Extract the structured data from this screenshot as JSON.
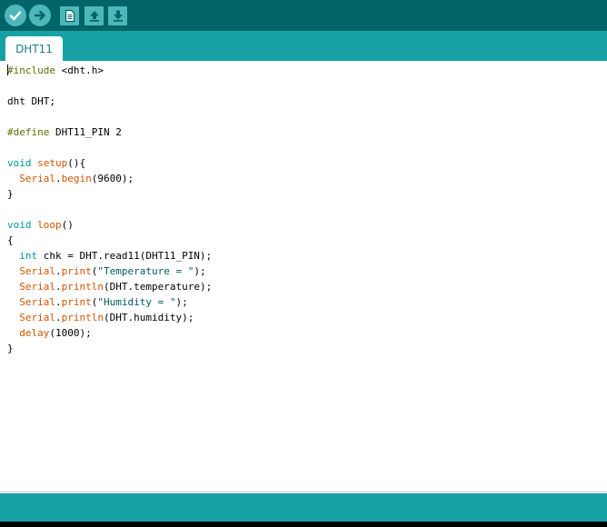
{
  "toolbar": {
    "buttons": [
      {
        "name": "verify",
        "icon": "check-icon"
      },
      {
        "name": "upload",
        "icon": "arrow-right-icon"
      },
      {
        "name": "new",
        "icon": "document-icon"
      },
      {
        "name": "open",
        "icon": "arrow-up-icon"
      },
      {
        "name": "save",
        "icon": "arrow-down-icon"
      }
    ]
  },
  "tabs": [
    {
      "label": "DHT11",
      "active": true
    }
  ],
  "editor": {
    "lines": [
      [
        {
          "t": "#include",
          "c": "olive"
        },
        {
          "t": " <dht.h>",
          "c": "plain"
        }
      ],
      [],
      [
        {
          "t": "dht DHT;",
          "c": "plain"
        }
      ],
      [],
      [
        {
          "t": "#define",
          "c": "olive"
        },
        {
          "t": " DHT11_PIN 2",
          "c": "plain"
        }
      ],
      [],
      [
        {
          "t": "void",
          "c": "blue"
        },
        {
          "t": " ",
          "c": "plain"
        },
        {
          "t": "setup",
          "c": "orange"
        },
        {
          "t": "(){",
          "c": "plain"
        }
      ],
      [
        {
          "t": "  ",
          "c": "plain"
        },
        {
          "t": "Serial",
          "c": "orange"
        },
        {
          "t": ".",
          "c": "plain"
        },
        {
          "t": "begin",
          "c": "orange"
        },
        {
          "t": "(9600);",
          "c": "plain"
        }
      ],
      [
        {
          "t": "}",
          "c": "plain"
        }
      ],
      [],
      [
        {
          "t": "void",
          "c": "blue"
        },
        {
          "t": " ",
          "c": "plain"
        },
        {
          "t": "loop",
          "c": "orange"
        },
        {
          "t": "()",
          "c": "plain"
        }
      ],
      [
        {
          "t": "{",
          "c": "plain"
        }
      ],
      [
        {
          "t": "  ",
          "c": "plain"
        },
        {
          "t": "int",
          "c": "blue"
        },
        {
          "t": " chk = DHT.read11(DHT11_PIN);",
          "c": "plain"
        }
      ],
      [
        {
          "t": "  ",
          "c": "plain"
        },
        {
          "t": "Serial",
          "c": "orange"
        },
        {
          "t": ".",
          "c": "plain"
        },
        {
          "t": "print",
          "c": "orange"
        },
        {
          "t": "(",
          "c": "plain"
        },
        {
          "t": "\"Temperature = \"",
          "c": "string"
        },
        {
          "t": ");",
          "c": "plain"
        }
      ],
      [
        {
          "t": "  ",
          "c": "plain"
        },
        {
          "t": "Serial",
          "c": "orange"
        },
        {
          "t": ".",
          "c": "plain"
        },
        {
          "t": "println",
          "c": "orange"
        },
        {
          "t": "(DHT.temperature);",
          "c": "plain"
        }
      ],
      [
        {
          "t": "  ",
          "c": "plain"
        },
        {
          "t": "Serial",
          "c": "orange"
        },
        {
          "t": ".",
          "c": "plain"
        },
        {
          "t": "print",
          "c": "orange"
        },
        {
          "t": "(",
          "c": "plain"
        },
        {
          "t": "\"Humidity = \"",
          "c": "string"
        },
        {
          "t": ");",
          "c": "plain"
        }
      ],
      [
        {
          "t": "  ",
          "c": "plain"
        },
        {
          "t": "Serial",
          "c": "orange"
        },
        {
          "t": ".",
          "c": "plain"
        },
        {
          "t": "println",
          "c": "orange"
        },
        {
          "t": "(DHT.humidity);",
          "c": "plain"
        }
      ],
      [
        {
          "t": "  ",
          "c": "plain"
        },
        {
          "t": "delay",
          "c": "orange"
        },
        {
          "t": "(1000);",
          "c": "plain"
        }
      ],
      [
        {
          "t": "}",
          "c": "plain"
        }
      ]
    ]
  },
  "colors": {
    "toolbar_bg": "#006468",
    "tabbar_bg": "#17a1a5",
    "button_bg": "#4db7bb",
    "keyword_orange": "#d35400",
    "keyword_blue": "#00979c",
    "preprocessor": "#5e6d03",
    "string": "#005c5f"
  }
}
